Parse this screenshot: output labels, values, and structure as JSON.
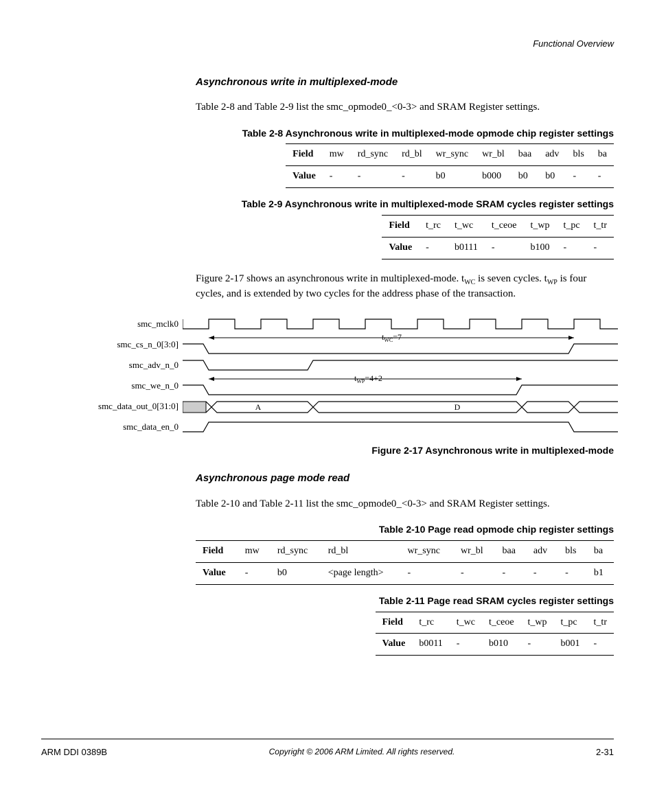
{
  "running_head": "Functional Overview",
  "section1": {
    "heading": "Asynchronous write in multiplexed-mode",
    "intro": "Table 2-8 and Table 2-9 list the smc_opmode0_<0-3> and SRAM Register settings."
  },
  "table28": {
    "caption": "Table 2-8 Asynchronous write in multiplexed-mode opmode chip register settings",
    "fields": [
      "Field",
      "mw",
      "rd_sync",
      "rd_bl",
      "wr_sync",
      "wr_bl",
      "baa",
      "adv",
      "bls",
      "ba"
    ],
    "values": [
      "Value",
      "-",
      "-",
      "-",
      "b0",
      "b000",
      "b0",
      "b0",
      "-",
      "-"
    ]
  },
  "table29": {
    "caption": "Table 2-9 Asynchronous write in multiplexed-mode SRAM cycles register settings",
    "fields": [
      "Field",
      "t_rc",
      "t_wc",
      "t_ceoe",
      "t_wp",
      "t_pc",
      "t_tr"
    ],
    "values": [
      "Value",
      "-",
      "b0111",
      "-",
      "b100",
      "-",
      "-"
    ]
  },
  "para_after_t29_a": "Figure 2-17 shows an asynchronous write in multiplexed-mode. t",
  "para_after_t29_b": " is seven cycles. t",
  "para_after_t29_c": " is four cycles, and is extended by two cycles for the address phase of the transaction.",
  "sub_wc": "WC",
  "sub_wp": "WP",
  "figure": {
    "signals": [
      "smc_mclk0",
      "smc_cs_n_0[3:0]",
      "smc_adv_n_0",
      "smc_we_n_0",
      "smc_data_out_0[31:0]",
      "smc_data_en_0"
    ],
    "twc_label": "t",
    "twc_val": "=7",
    "twp_label": "t",
    "twp_val": "=4+2",
    "A": "A",
    "D": "D",
    "caption": "Figure 2-17 Asynchronous write in multiplexed-mode"
  },
  "section2": {
    "heading": "Asynchronous page mode read",
    "intro": "Table 2-10 and Table 2-11 list the smc_opmode0_<0-3> and SRAM Register settings."
  },
  "table210": {
    "caption": "Table 2-10 Page read opmode chip register settings",
    "fields": [
      "Field",
      "mw",
      "rd_sync",
      "rd_bl",
      "wr_sync",
      "wr_bl",
      "baa",
      "adv",
      "bls",
      "ba"
    ],
    "values": [
      "Value",
      "-",
      "b0",
      "<page length>",
      "-",
      "-",
      "-",
      "-",
      "-",
      "b1"
    ]
  },
  "table211": {
    "caption": "Table 2-11 Page read SRAM cycles register settings",
    "fields": [
      "Field",
      "t_rc",
      "t_wc",
      "t_ceoe",
      "t_wp",
      "t_pc",
      "t_tr"
    ],
    "values": [
      "Value",
      "b0011",
      "-",
      "b010",
      "-",
      "b001",
      "-"
    ]
  },
  "footer": {
    "left": "ARM DDI 0389B",
    "center": "Copyright © 2006 ARM Limited. All rights reserved.",
    "right": "2-31"
  }
}
